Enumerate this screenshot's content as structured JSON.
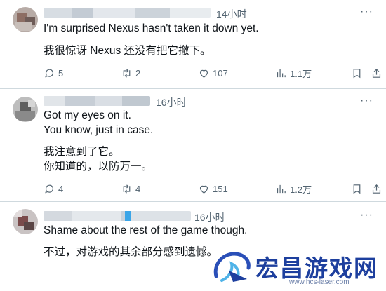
{
  "tweets": [
    {
      "time": "14小时",
      "lines": [
        "I'm surprised Nexus hasn't taken it down yet.",
        "我很惊讶 Nexus 还没有把它撤下。"
      ],
      "replies": "5",
      "retweets": "2",
      "likes": "107",
      "views": "1.1万"
    },
    {
      "time": "16小时",
      "lines": [
        "Got my eyes on it.",
        "You know, just in case.",
        "我注意到了它。",
        "你知道的，以防万一。"
      ],
      "replies": "4",
      "retweets": "4",
      "likes": "151",
      "views": "1.2万"
    },
    {
      "time": "16小时",
      "lines": [
        "Shame about the rest of the game though.",
        "不过，对游戏的其余部分感到遗憾。"
      ]
    }
  ],
  "more_label": "···",
  "icons": {
    "reply": "reply-icon",
    "retweet": "retweet-icon",
    "like": "heart-icon",
    "views": "views-icon",
    "bookmark": "bookmark-icon",
    "share": "share-icon"
  },
  "watermark": {
    "title": "宏昌游戏网",
    "url": "www.hcs-laser.com"
  },
  "colors": {
    "text": "#0f1419",
    "muted": "#536471",
    "divider": "#cfd9de",
    "watermark": "#1d3f9e"
  }
}
